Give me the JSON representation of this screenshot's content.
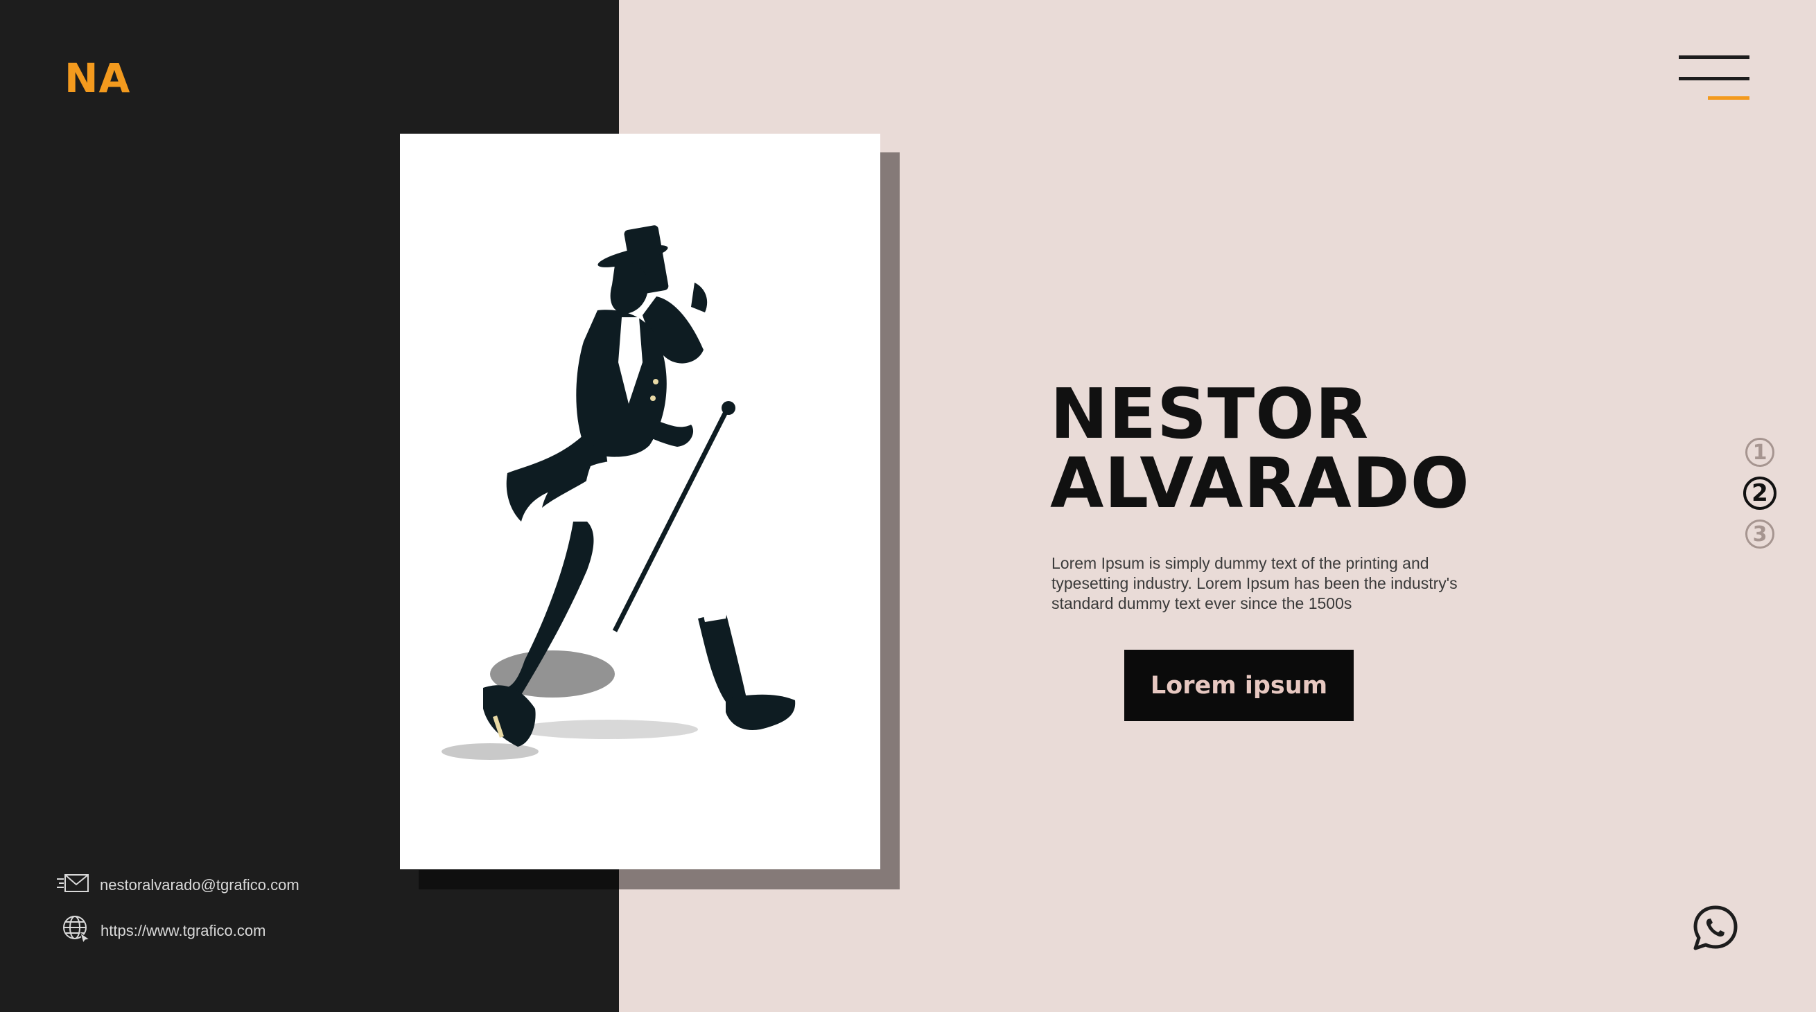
{
  "brand": {
    "logo": "NA",
    "accent_color": "#f39a1e"
  },
  "colors": {
    "dark_panel": "#1d1d1d",
    "light_panel": "#e9dbd7"
  },
  "header": {
    "menu_icon": "hamburger-menu-icon"
  },
  "hero": {
    "title_line1": "NESTOR",
    "title_line2": "ALVARADO",
    "description": "Lorem Ipsum is simply dummy text of the printing and typesetting industry. Lorem Ipsum has been the industry's standard dummy text ever since the 1500s",
    "cta_label": "Lorem ipsum"
  },
  "pager": {
    "pages": [
      "1",
      "2",
      "3"
    ],
    "active_index": 1
  },
  "contact": {
    "email": "nestoralvarado@tgrafico.com",
    "website": "https://www.tgrafico.com",
    "email_icon": "mail-icon",
    "web_icon": "globe-icon"
  },
  "floating": {
    "chat_icon": "whatsapp-icon"
  }
}
